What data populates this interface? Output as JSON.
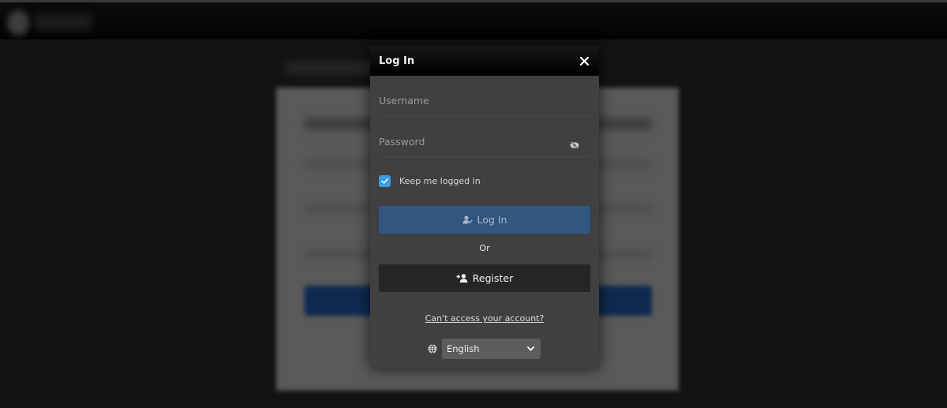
{
  "modal": {
    "title": "Log In",
    "username_placeholder": "Username",
    "password_placeholder": "Password",
    "keep_logged_in_label": "Keep me logged in",
    "keep_logged_in_checked": true,
    "login_button_label": "Log In",
    "or_label": "Or",
    "register_button_label": "Register",
    "forgot_link_label": "Can't access your account?",
    "language_selected": "English"
  },
  "colors": {
    "checkbox": "#3d9be0",
    "login_button": "#315680",
    "register_button": "#262626"
  },
  "icons": {
    "close": "close-icon",
    "password_visibility": "eye-slash-icon",
    "login": "user-check-icon",
    "register": "user-plus-icon",
    "language": "globe-icon",
    "dropdown": "chevron-down-icon"
  }
}
